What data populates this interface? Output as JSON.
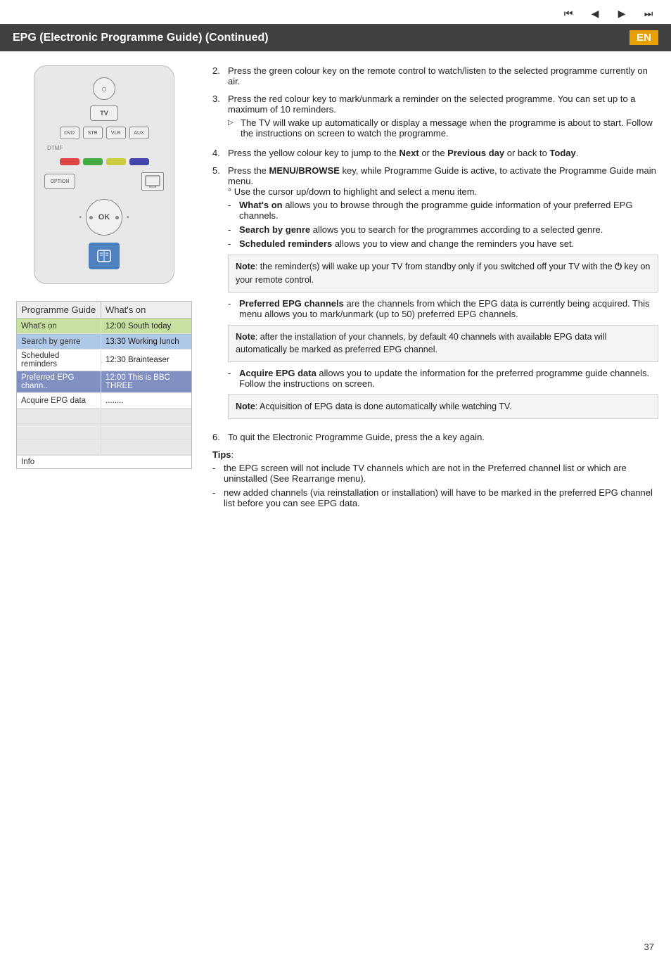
{
  "topNav": {
    "buttons": [
      "⏮",
      "◀",
      "▶",
      "⏭"
    ]
  },
  "titleBar": {
    "title": "EPG (Electronic Programme Guide) (Continued)",
    "badge": "EN"
  },
  "remote": {
    "power": "○",
    "tv": "TV",
    "sources": [
      "DVD",
      "STB",
      "VLR",
      "AUX"
    ],
    "option": "OPTION",
    "ok": "OK",
    "colorBtns": [
      "red",
      "green",
      "yellow",
      "blue"
    ]
  },
  "epgMenu": {
    "header": {
      "left": "Programme Guide",
      "right": "What's on"
    },
    "rows": [
      {
        "left": "What's on",
        "right": "12:00 South today",
        "style": "highlight"
      },
      {
        "left": "Search by genre",
        "right": "13:30 Working lunch",
        "style": "highlight2"
      },
      {
        "left": "Scheduled reminders",
        "right": "12:30 Brainteaser",
        "style": ""
      },
      {
        "left": "Preferred EPG chann..",
        "right": "12:00 This is BBC THREE",
        "style": "highlight3"
      },
      {
        "left": "Acquire EPG data",
        "right": "........",
        "style": ""
      },
      {
        "left": "",
        "right": "",
        "style": "empty"
      },
      {
        "left": "",
        "right": "",
        "style": "empty"
      },
      {
        "left": "",
        "right": "",
        "style": "empty"
      }
    ],
    "infoLabel": "Info"
  },
  "instructions": {
    "step2": {
      "num": "2.",
      "text": "Press the green colour key on the remote control to watch/listen to the selected programme currently on air."
    },
    "step3": {
      "num": "3.",
      "text": "Press the red colour key to mark/unmark a reminder on the selected programme. You can set up to a maximum of 10 reminders.",
      "sub": [
        "The TV will wake up automatically or display a message when the programme is about to start. Follow the instructions on screen to watch the programme."
      ]
    },
    "step4": {
      "num": "4.",
      "text1": "Press the yellow colour key to jump to the ",
      "bold1": "Next",
      "text2": " or the ",
      "bold2": "Previous day",
      "text3": " or back to ",
      "bold3": "Today",
      "text4": "."
    },
    "step5": {
      "num": "5.",
      "text1": "Press the ",
      "bold1": "MENU/BROWSE",
      "text2": " key, while Programme Guide is active, to activate the Programme Guide main menu.",
      "note": "° Use the cursor up/down to highlight and select a menu item.",
      "dashItems": [
        {
          "bold": "What's on",
          "text": " allows you to browse through the programme guide information of your preferred EPG channels."
        },
        {
          "bold": "Search by genre",
          "text": " allows you to search for the programmes according to a selected genre."
        },
        {
          "bold": "Scheduled reminders",
          "text": " allows you to view and change the reminders you have set."
        }
      ],
      "noteBox1": {
        "text1": "Note",
        "text2": ": the reminder(s) will wake up your TV from standby only if you switched off your TV with the ",
        "symbol": "⏻",
        "text3": " key on your remote control."
      },
      "dashItems2": [
        {
          "bold": "Preferred EPG channels",
          "text": " are the channels from which the EPG data is currently being  acquired. This menu allows you to mark/unmark (up to 50) preferred EPG channels."
        }
      ],
      "noteBox2": {
        "text1": "Note",
        "text2": ": after the installation of your channels, by default 40 channels with available EPG data will automatically be marked as preferred EPG channel."
      },
      "dashItems3": [
        {
          "bold": "Acquire EPG data",
          "text": " allows you to update the information for the preferred programme guide channels. Follow the instructions on screen."
        }
      ],
      "noteBox3": {
        "text1": "Note",
        "text2": ": Acquisition of EPG data is done automatically while watching TV."
      }
    },
    "step6": {
      "num": "6.",
      "text": "To quit the Electronic Programme Guide, press the a key again."
    },
    "tips": {
      "label": "Tips",
      "items": [
        "the EPG screen will not include TV channels which are not in the Preferred channel list or which are uninstalled (See Rearrange menu).",
        "new added channels (via reinstallation or installation) will have to be marked in the preferred EPG channel list before you can see EPG data."
      ]
    }
  },
  "pageNumber": "37"
}
